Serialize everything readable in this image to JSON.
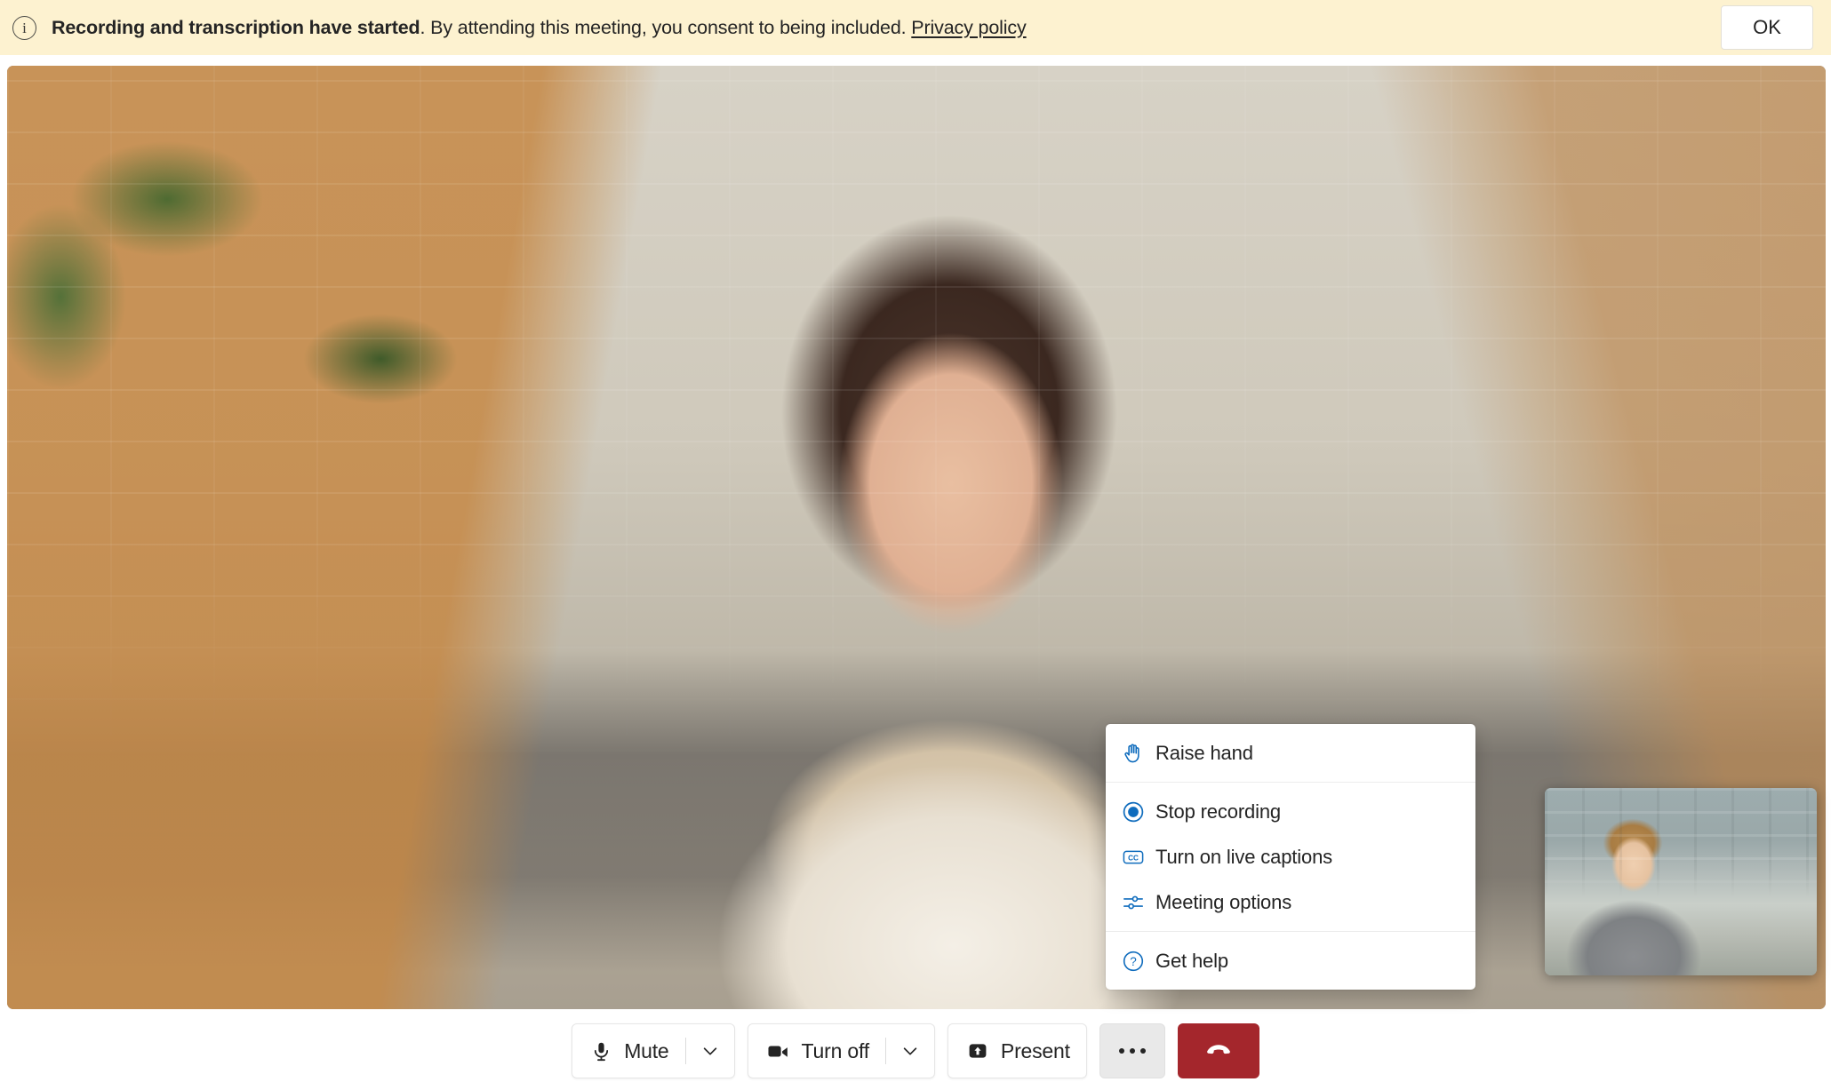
{
  "banner": {
    "icon": "info-circle-icon",
    "strong_text": "Recording and transcription have started",
    "body_text": ". By attending this meeting, you consent to being included. ",
    "link_text": "Privacy policy",
    "ok_label": "OK",
    "background_color": "#fdf2d0"
  },
  "stage": {
    "main_video_label": "main-participant-video",
    "self_view_label": "self-view-video"
  },
  "menu": {
    "groups": [
      {
        "items": [
          {
            "icon": "raise-hand-icon",
            "label": "Raise hand"
          }
        ]
      },
      {
        "items": [
          {
            "icon": "stop-recording-icon",
            "label": "Stop recording"
          },
          {
            "icon": "closed-captions-icon",
            "label": "Turn on live captions"
          },
          {
            "icon": "meeting-options-icon",
            "label": "Meeting options"
          }
        ]
      },
      {
        "items": [
          {
            "icon": "help-circle-icon",
            "label": "Get help"
          }
        ]
      }
    ],
    "accent_color": "#0f6cbd"
  },
  "controls": {
    "mic": {
      "icon": "microphone-icon",
      "label": "Mute",
      "caret": "chevron-down-icon"
    },
    "camera": {
      "icon": "video-camera-icon",
      "label": "Turn off",
      "caret": "chevron-down-icon"
    },
    "present": {
      "icon": "share-screen-icon",
      "label": "Present"
    },
    "more": {
      "icon": "more-horizontal-icon",
      "label": "More actions",
      "active": true
    },
    "hangup": {
      "icon": "hangup-phone-icon",
      "label": "Leave",
      "color": "#a4262c"
    }
  }
}
